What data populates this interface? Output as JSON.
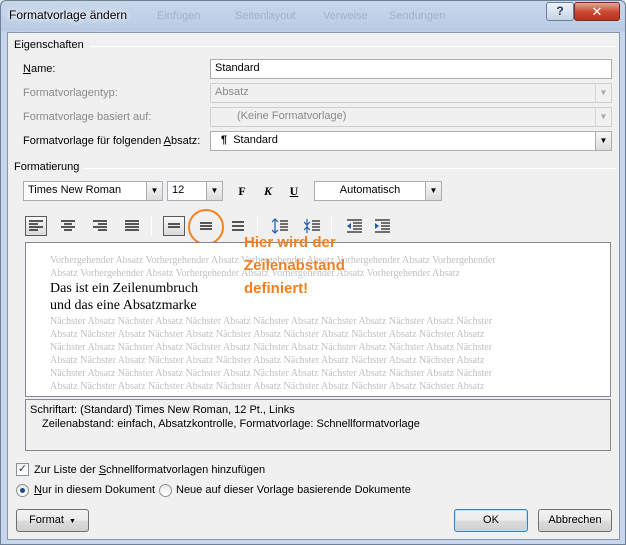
{
  "window": {
    "title": "Formatvorlage ändern",
    "title_background_text": [
      "Einfügen",
      "Seitenlayout",
      "Verweise",
      "Sendungen"
    ],
    "help_label": "?",
    "close_label": "✕"
  },
  "properties": {
    "group_label": "Eigenschaften",
    "name_label": "Name:",
    "name_value": "Standard",
    "type_label": "Formatvorlagentyp:",
    "type_value": "Absatz",
    "based_on_label": "Formatvorlage basiert auf:",
    "based_on_value": "(Keine Formatvorlage)",
    "next_label": "Formatvorlage für folgenden Absatz:",
    "next_icon": "¶",
    "next_value": "Standard"
  },
  "formatting": {
    "group_label": "Formatierung",
    "font": "Times New Roman",
    "size": "12",
    "bold_label": "F",
    "italic_label": "K",
    "underline_label": "U",
    "color": "Automatisch"
  },
  "icons": {
    "align_left": "align-left-icon",
    "align_center": "align-center-icon",
    "align_right": "align-right-icon",
    "justify": "justify-icon",
    "single_spacing": "single-spacing-icon",
    "one_half_spacing": "one-half-spacing-icon",
    "double_spacing": "double-spacing-icon",
    "space_before_increase": "space-before-increase-icon",
    "space_before_decrease": "space-before-decrease-icon",
    "indent_decrease": "indent-decrease-icon",
    "indent_increase": "indent-increase-icon"
  },
  "preview": {
    "previous_lines": [
      "Vorhergehender Absatz Vorhergehender Absatz Vorhergehender Absatz Vorhergehender Absatz Vorhergehender",
      "Absatz Vorhergehender Absatz Vorhergehender Absatz Vorhergehender Absatz Vorhergehender Absatz"
    ],
    "sample_lines": [
      "Das ist ein Zeilenumbruch",
      "und das eine Absatzmarke"
    ],
    "next_lines": [
      "Nächster Absatz Nächster Absatz Nächster Absatz Nächster Absatz Nächster Absatz Nächster Absatz Nächster",
      "Absatz Nächster Absatz Nächster Absatz Nächster Absatz Nächster Absatz Nächster Absatz Nächster Absatz",
      "Nächster Absatz Nächster Absatz Nächster Absatz Nächster Absatz Nächster Absatz Nächster Absatz Nächster",
      "Absatz Nächster Absatz Nächster Absatz Nächster Absatz Nächster Absatz Nächster Absatz Nächster Absatz",
      "Nächster Absatz Nächster Absatz Nächster Absatz Nächster Absatz Nächster Absatz Nächster Absatz Nächster",
      "Absatz Nächster Absatz Nächster Absatz Nächster Absatz Nächster Absatz Nächster Absatz Nächster Absatz"
    ]
  },
  "annotation": {
    "lines": [
      "Hier wird der",
      "Zeilenabstand",
      "definiert!"
    ],
    "color": "#f0801f"
  },
  "description": {
    "line1": "Schriftart: (Standard) Times New Roman, 12 Pt., Links",
    "line2": "Zeilenabstand:  einfach, Absatzkontrolle, Formatvorlage: Schnellformatvorlage"
  },
  "options": {
    "quick_list_label": "Zur Liste der Schnellformatvorlagen hinzufügen",
    "quick_list_checked": true,
    "only_doc_label": "Nur in diesem Dokument",
    "new_docs_label": "Neue auf dieser Vorlage basierende Dokumente"
  },
  "buttons": {
    "format_label": "Format",
    "ok_label": "OK",
    "cancel_label": "Abbrechen"
  }
}
